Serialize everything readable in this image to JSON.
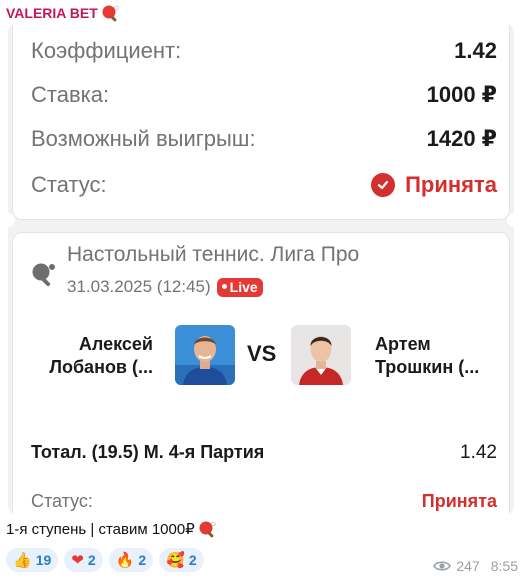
{
  "channel": {
    "name": "VALERIA BET"
  },
  "coupon": {
    "rows": [
      {
        "label": "Коэффициент:",
        "value": "1.42"
      },
      {
        "label": "Ставка:",
        "value": "1000 ₽"
      },
      {
        "label": "Возможный выигрыш:",
        "value": "1420 ₽"
      }
    ],
    "status": {
      "label": "Статус:",
      "value": "Принята"
    },
    "event": {
      "league": "Настольный теннис. Лига Про",
      "datetime": "31.03.2025 (12:45)",
      "live_label": "Live",
      "player1": [
        "Алексей",
        "Лобанов (..."
      ],
      "player2": [
        "Артем",
        "Трошкин (..."
      ],
      "vs": "VS"
    },
    "market": {
      "name": "Тотал. (19.5) М. 4-я Партия",
      "odds": "1.42"
    },
    "market_status": {
      "label": "Статус:",
      "value": "Принята"
    }
  },
  "message": {
    "caption": "1-я ступень | ставим 1000₽",
    "reactions": [
      {
        "emoji": "👍",
        "count": "19"
      },
      {
        "emoji": "❤",
        "count": "2"
      },
      {
        "emoji": "🔥",
        "count": "2"
      },
      {
        "emoji": "🥰",
        "count": "2"
      }
    ],
    "views": "247",
    "time": "8:55"
  },
  "colors": {
    "accent_red": "#d32f2f",
    "sender": "#c2185b",
    "reaction_bg": "#e8f1fb"
  }
}
